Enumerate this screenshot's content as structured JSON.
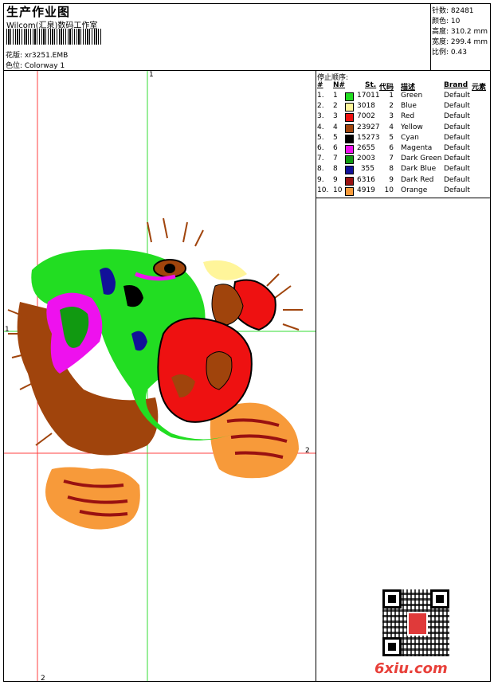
{
  "header": {
    "title": "生产作业图",
    "studio": "Wilcom(汇泉)数码工作室",
    "design_label": "花版: xr3251.EMB",
    "colorway_label": "色位: Colorway 1"
  },
  "stats": [
    "针数: 82481",
    "颜色: 10",
    "高度: 310.2 mm",
    "宽度: 299.4 mm",
    "比例: 0.43"
  ],
  "stop_sequence": {
    "title": "停止顺序:",
    "headers": {
      "num": "#",
      "n": "N#",
      "st": "St.",
      "code": "代码",
      "desc": "描述",
      "brand": "Brand",
      "elem": "元素"
    },
    "rows": [
      {
        "num": "1.",
        "n": "1",
        "st": "17011",
        "code": "1",
        "desc": "Green",
        "brand": "Default",
        "color": "#22dd22"
      },
      {
        "num": "2.",
        "n": "2",
        "st": "3018",
        "code": "2",
        "desc": "Blue",
        "brand": "Default",
        "color": "#fff59a"
      },
      {
        "num": "3.",
        "n": "3",
        "st": "7002",
        "code": "3",
        "desc": "Red",
        "brand": "Default",
        "color": "#ee1111"
      },
      {
        "num": "4.",
        "n": "4",
        "st": "23927",
        "code": "4",
        "desc": "Yellow",
        "brand": "Default",
        "color": "#a0440c"
      },
      {
        "num": "5.",
        "n": "5",
        "st": "15273",
        "code": "5",
        "desc": "Cyan",
        "brand": "Default",
        "color": "#000000"
      },
      {
        "num": "6.",
        "n": "6",
        "st": "2655",
        "code": "6",
        "desc": "Magenta",
        "brand": "Default",
        "color": "#ee11ee"
      },
      {
        "num": "7.",
        "n": "7",
        "st": "2003",
        "code": "7",
        "desc": "Dark Green",
        "brand": "Default",
        "color": "#119911"
      },
      {
        "num": "8.",
        "n": "8",
        "st": "355",
        "code": "8",
        "desc": "Dark Blue",
        "brand": "Default",
        "color": "#111199"
      },
      {
        "num": "9.",
        "n": "9",
        "st": "6316",
        "code": "9",
        "desc": "Dark Red",
        "brand": "Default",
        "color": "#991111"
      },
      {
        "num": "10.",
        "n": "10",
        "st": "4919",
        "code": "10",
        "desc": "Orange",
        "brand": "Default",
        "color": "#f79a3a"
      }
    ]
  },
  "guides": {
    "v1": "1",
    "h1": "1",
    "v2": "2",
    "h2": "2"
  },
  "watermark": "6xiu.com",
  "colors": {
    "guide_red": "#ff4040",
    "guide_green": "#33dd33"
  }
}
